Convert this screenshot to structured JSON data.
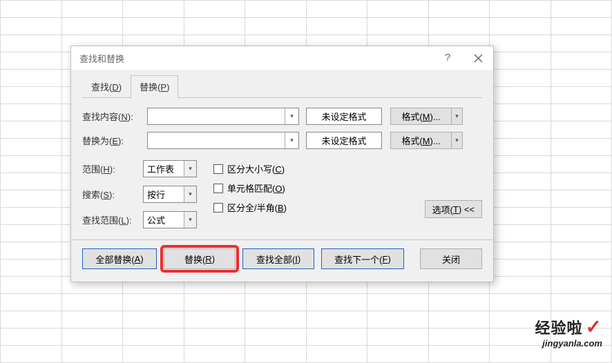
{
  "dialog": {
    "title": "查找和替换",
    "tabs": {
      "find": "查找(D)",
      "replace": "替换(P)"
    },
    "fields": {
      "find_label": "查找内容(N):",
      "replace_label": "替换为(E):",
      "find_value": "",
      "replace_value": "",
      "format_not_set": "未设定格式",
      "format_btn": "格式(M)..."
    },
    "options": {
      "scope_label": "范围(H):",
      "scope_value": "工作表",
      "search_label": "搜索(S):",
      "search_value": "按行",
      "lookin_label": "查找范围(L):",
      "lookin_value": "公式",
      "match_case": "区分大小写(C)",
      "match_cell": "单元格匹配(O)",
      "match_width": "区分全/半角(B)",
      "options_btn": "选项(T) <<"
    },
    "buttons": {
      "replace_all": "全部替换(A)",
      "replace": "替换(R)",
      "find_all": "查找全部(I)",
      "find_next": "查找下一个(F)",
      "close": "关闭"
    }
  },
  "watermark": {
    "brand": "经验啦",
    "url": "jingyanla.com"
  }
}
